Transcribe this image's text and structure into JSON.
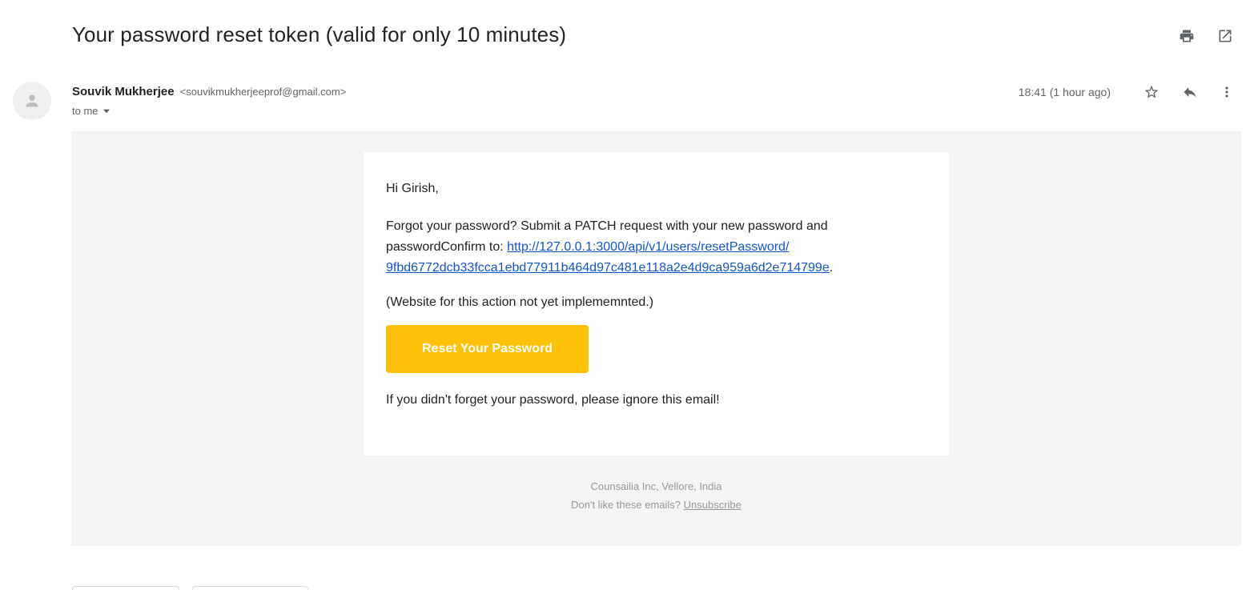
{
  "email": {
    "subject": "Your password reset token (valid for only 10 minutes)",
    "sender_name": "Souvik Mukherjee",
    "sender_email": "<souvikmukherjeeprof@gmail.com>",
    "recipient": "to me",
    "timestamp": "18:41 (1 hour ago)"
  },
  "message": {
    "greeting": "Hi Girish,",
    "intro": "Forgot your password? Submit a PATCH request with your new password and passwordConfirm to: ",
    "link_line1": "http://127.0.0.1:3000/api/v1/users/resetPassword/",
    "link_line2": "9fbd6772dcb33fcca1ebd77911b464d97c481e118a2e4d9ca959a6d2e714799e",
    "link_suffix": ".",
    "note": "(Website for this action not yet implememnted.)",
    "button_label": "Reset Your Password",
    "ignore": "If you didn't forget your password, please ignore this email!"
  },
  "footer": {
    "company": "Counsailia Inc, Vellore, India",
    "unsubscribe_prefix": "Don't like these emails? ",
    "unsubscribe_link": "Unsubscribe"
  },
  "icons": {
    "print": "printer-icon",
    "popout": "open-in-new-window-icon",
    "star": "star-icon",
    "reply": "reply-icon",
    "more": "more-vertical-icon",
    "avatar": "person-icon",
    "dropdown": "caret-down-icon"
  },
  "colors": {
    "button": "#ffc107",
    "link": "#1155cc",
    "body_background": "#f4f4f4"
  }
}
